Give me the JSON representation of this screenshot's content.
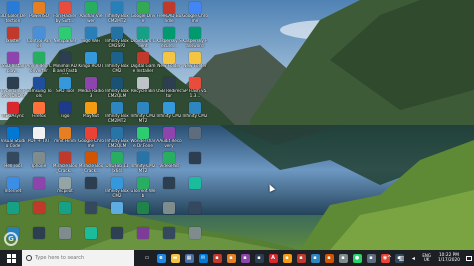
{
  "desktop": {
    "icons": [
      {
        "label": "3D Color Detection",
        "icon": "app-icon",
        "color": "#2a7ad8"
      },
      {
        "label": "Ixlister",
        "icon": "app-icon",
        "color": "#c0392b"
      },
      {
        "label": "SSD Install play...",
        "icon": "app-icon",
        "color": "#8e44ad"
      },
      {
        "label": "CyberLink PowerDVD 9",
        "icon": "disc-icon",
        "color": "#2c3e50"
      },
      {
        "label": "MEGAsync",
        "icon": "app-icon",
        "color": "#d9272e"
      },
      {
        "label": "Visual Studio Code",
        "icon": "code-icon",
        "color": "#0078d4"
      },
      {
        "label": "Hell Tool",
        "icon": "app-icon",
        "color": "#34495e"
      },
      {
        "label": "Internet",
        "icon": "globe-icon",
        "color": "#3a8ee6"
      },
      {
        "label": "",
        "icon": "app-icon",
        "color": "#16a085"
      },
      {
        "label": "",
        "icon": "app-icon",
        "color": "#2980b9"
      },
      {
        "label": "PowerISO",
        "icon": "disc-icon",
        "color": "#e67e22"
      },
      {
        "label": "Control Panel",
        "icon": "gear-icon",
        "color": "#4a90d9"
      },
      {
        "label": "Any Video Converter",
        "icon": "video-icon",
        "color": "#27ae60"
      },
      {
        "label": "Samsung Tools",
        "icon": "app-icon",
        "color": "#1f4e9c"
      },
      {
        "label": "Firefox",
        "icon": "browser-icon",
        "color": "#ff7139"
      },
      {
        "label": "PDF + TXT",
        "icon": "document-icon",
        "color": "#f1f1f1"
      },
      {
        "label": "Iphone",
        "icon": "phone-icon",
        "color": "#7f8c8d"
      },
      {
        "label": "",
        "icon": "app-icon",
        "color": "#8e44ad"
      },
      {
        "label": "",
        "icon": "app-icon",
        "color": "#c0392b"
      },
      {
        "label": "",
        "icon": "app-icon",
        "color": "#2c3e50"
      },
      {
        "label": "Fon Hacker by Soft...",
        "icon": "app-icon",
        "color": "#e74c3c"
      },
      {
        "label": "Netsparker",
        "icon": "app-icon",
        "color": "#2ecc71"
      },
      {
        "label": "Minimal ADB and Fastboot",
        "icon": "terminal-icon",
        "color": "#2c3e50"
      },
      {
        "label": "SPD Tool",
        "icon": "app-icon",
        "color": "#3498db"
      },
      {
        "label": "Tigo",
        "icon": "app-icon",
        "color": "#1e3a8a"
      },
      {
        "label": "mnit Hindi",
        "icon": "app-icon",
        "color": "#e67e22"
      },
      {
        "label": "Miracle Box_Crack...",
        "icon": "app-icon",
        "color": "#c0392b"
      },
      {
        "label": "mcpilot",
        "icon": "app-icon",
        "color": "#95a5a6"
      },
      {
        "label": "",
        "icon": "app-icon",
        "color": "#16a085"
      },
      {
        "label": "",
        "icon": "app-icon",
        "color": "#7f8c8d"
      },
      {
        "label": "Aadhar Viewer",
        "icon": "app-icon",
        "color": "#27ae60"
      },
      {
        "label": "Tigo WiFi",
        "icon": "wifi-icon",
        "color": "#2980b9"
      },
      {
        "label": "Kingo ROOT",
        "icon": "app-icon",
        "color": "#3498db"
      },
      {
        "label": "Media Radio 3",
        "icon": "media-icon",
        "color": "#8e44ad"
      },
      {
        "label": "PlayNut",
        "icon": "app-icon",
        "color": "#f39c12"
      },
      {
        "label": "Google Chrome",
        "icon": "chrome-icon",
        "color": "#ea4335"
      },
      {
        "label": "Miracle Box_Crack...",
        "icon": "app-icon",
        "color": "#d35400"
      },
      {
        "label": "",
        "icon": "app-icon",
        "color": "#2c3e50"
      },
      {
        "label": "",
        "icon": "app-icon",
        "color": "#34495e"
      },
      {
        "label": "",
        "icon": "app-icon",
        "color": "#1abc9c"
      },
      {
        "label": "Infinity Box CM2MT2",
        "icon": "app-icon",
        "color": "#2980b9"
      },
      {
        "label": "Infinity Box CM2SP2",
        "icon": "app-icon",
        "color": "#2471a3"
      },
      {
        "label": "Infinity Box CM2",
        "icon": "app-icon",
        "color": "#1f618d"
      },
      {
        "label": "Infinity Box CM2QLM",
        "icon": "app-icon",
        "color": "#1a5276"
      },
      {
        "label": "Infinity Box CM2MT2",
        "icon": "app-icon",
        "color": "#2e86c1"
      },
      {
        "label": "Infinity Box CM2QLM",
        "icon": "app-icon",
        "color": "#2874a6"
      },
      {
        "label": "DVDFab 11 (x64)",
        "icon": "disc-icon",
        "color": "#27ae60"
      },
      {
        "label": "Infinity Box CM2",
        "icon": "app-icon",
        "color": "#3498db"
      },
      {
        "label": "",
        "icon": "app-icon",
        "color": "#5dade2"
      },
      {
        "label": "",
        "icon": "app-icon",
        "color": "#2e4053"
      },
      {
        "label": "Google Drive",
        "icon": "drive-icon",
        "color": "#34a853"
      },
      {
        "label": "DroidCam Client",
        "icon": "camera-icon",
        "color": "#16a085"
      },
      {
        "label": "Digital Game Installer",
        "icon": "app-icon",
        "color": "#c0392b"
      },
      {
        "label": "Recycle Bin",
        "icon": "trash-icon",
        "color": "#bdc3c7"
      },
      {
        "label": "Infinity CM2MT2",
        "icon": "app-icon",
        "color": "#2e86c1"
      },
      {
        "label": "Wondershare Dr.Fone",
        "icon": "app-icon",
        "color": "#2ecc71"
      },
      {
        "label": "Infinity CM2 MT2",
        "icon": "app-icon",
        "color": "#2874a6"
      },
      {
        "label": "uTorrent Web",
        "icon": "download-icon",
        "color": "#27ae60"
      },
      {
        "label": "",
        "icon": "app-icon",
        "color": "#1e8449"
      },
      {
        "label": "",
        "icon": "app-icon",
        "color": "#7d3c98"
      },
      {
        "label": "FreeCAD Bundle",
        "icon": "app-icon",
        "color": "#c0392b"
      },
      {
        "label": "Kaspersky Secure...",
        "icon": "shield-icon",
        "color": "#009a6e"
      },
      {
        "label": "New Folder",
        "icon": "folder-icon",
        "color": "#f4c542"
      },
      {
        "label": "USB Redirector",
        "icon": "usb-icon",
        "color": "#2c3e50"
      },
      {
        "label": "Infinity CM2",
        "icon": "app-icon",
        "color": "#3498db"
      },
      {
        "label": "AAudit Recovery",
        "icon": "app-icon",
        "color": "#8e44ad"
      },
      {
        "label": "VideoPad",
        "icon": "video-icon",
        "color": "#27ae60"
      },
      {
        "label": "",
        "icon": "app-icon",
        "color": "#2c3e50"
      },
      {
        "label": "",
        "icon": "app-icon",
        "color": "#7f8c8d"
      },
      {
        "label": "",
        "icon": "app-icon",
        "color": "#34495e"
      },
      {
        "label": "Google Chrome",
        "icon": "chrome-icon",
        "color": "#4285f4"
      },
      {
        "label": "Kaspersky Password",
        "icon": "shield-icon",
        "color": "#009a6e"
      },
      {
        "label": "New Folder",
        "icon": "folder-icon",
        "color": "#f4c542"
      },
      {
        "label": "SP Flash v5.1.3...",
        "icon": "app-icon",
        "color": "#e74c3c"
      },
      {
        "label": "Infinity CM2",
        "icon": "app-icon",
        "color": "#2e86c1"
      },
      {
        "label": "",
        "icon": "app-icon",
        "color": "#5d6d7e"
      },
      {
        "label": "",
        "icon": "app-icon",
        "color": "#2c3e50"
      },
      {
        "label": "",
        "icon": "app-icon",
        "color": "#1abc9c"
      },
      {
        "label": "",
        "icon": "app-icon",
        "color": "#34495e"
      },
      {
        "label": "",
        "icon": "app-icon",
        "color": "#7f8c8d"
      }
    ]
  },
  "taskbar": {
    "search_placeholder": "Type here to search",
    "apps": [
      {
        "name": "task-view",
        "glyph": "▭",
        "color": "#1c1f24"
      },
      {
        "name": "edge",
        "glyph": "e",
        "color": "#1e88e5"
      },
      {
        "name": "file-explorer",
        "glyph": "▬",
        "color": "#f4c542"
      },
      {
        "name": "store",
        "glyph": "▦",
        "color": "#4a6fa5"
      },
      {
        "name": "mail",
        "glyph": "✉",
        "color": "#0078d4"
      },
      {
        "name": "app",
        "glyph": "▪",
        "color": "#c0392b"
      },
      {
        "name": "app",
        "glyph": "▪",
        "color": "#e67e22"
      },
      {
        "name": "app",
        "glyph": "▪",
        "color": "#8e44ad"
      },
      {
        "name": "app",
        "glyph": "▪",
        "color": "#2c3e50"
      },
      {
        "name": "acrobat",
        "glyph": "A",
        "color": "#d9272e"
      },
      {
        "name": "app",
        "glyph": "▪",
        "color": "#f39c12"
      },
      {
        "name": "app",
        "glyph": "▪",
        "color": "#c0392b"
      },
      {
        "name": "app",
        "glyph": "▪",
        "color": "#2e86c1"
      },
      {
        "name": "app",
        "glyph": "▪",
        "color": "#d35400"
      },
      {
        "name": "app",
        "glyph": "▪",
        "color": "#7f8c8d"
      },
      {
        "name": "whatsapp",
        "glyph": "●",
        "color": "#25d366"
      },
      {
        "name": "app",
        "glyph": "▪",
        "color": "#5d6d7e"
      },
      {
        "name": "chrome",
        "glyph": "◉",
        "color": "#ea4335"
      },
      {
        "name": "app",
        "glyph": "▪",
        "color": "#34495e"
      }
    ],
    "tray_lang_1": "ENG",
    "tray_lang_2": "UK",
    "clock_time": "10:22 PM",
    "clock_date": "1/17/2020"
  }
}
